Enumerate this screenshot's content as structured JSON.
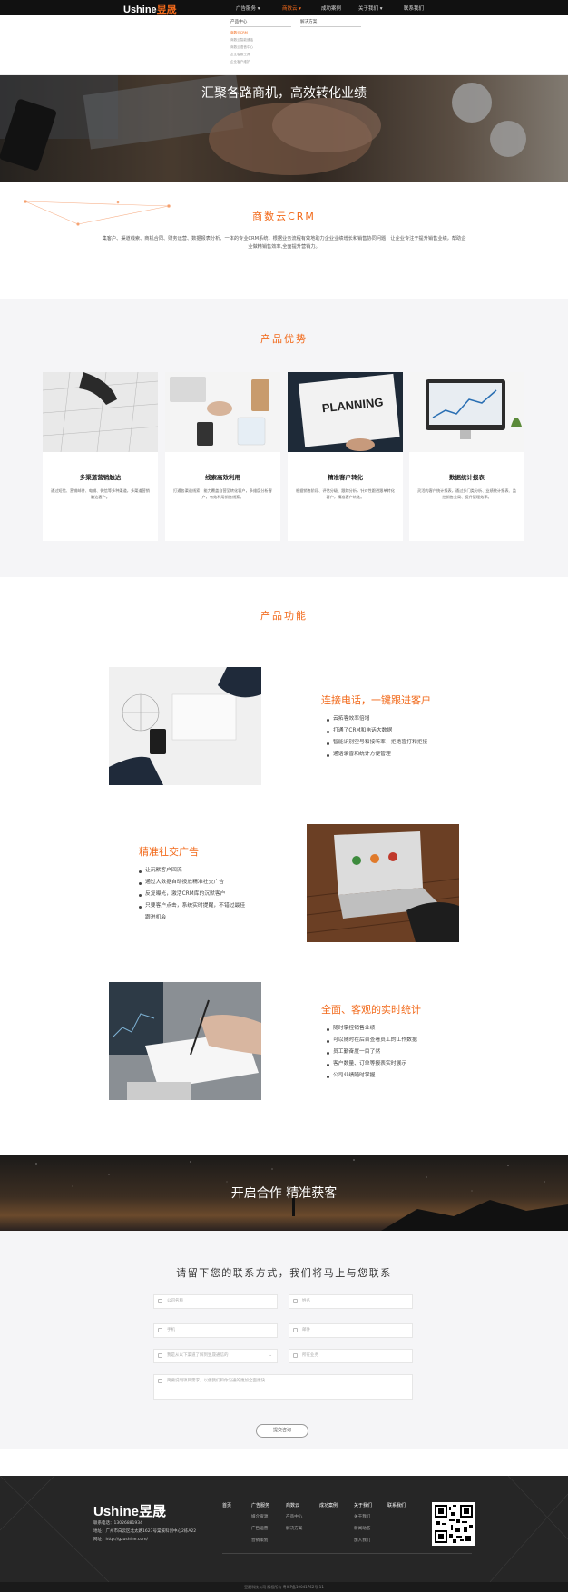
{
  "nav": {
    "logo_latin": "Ushine",
    "logo_cn": "昱晟",
    "items": [
      "广告服务",
      "商数云",
      "成功案例",
      "关于我们",
      "联系我们"
    ],
    "active_index": 1
  },
  "dropdown": {
    "col1_title": "产品中心",
    "col2_title": "解决方案",
    "sub_items": [
      "商数云CRM",
      "商数云智能通话",
      "商数云语音中心",
      "企业客服工具",
      "企业客户维护"
    ]
  },
  "banner": {
    "title": "汇聚各路商机，高效转化业绩"
  },
  "crm": {
    "title": "商数云CRM",
    "desc": "集客户、渠道线索、商机合同、财务运营、数据报表分析、一体的专业CRM系统，根据业务流程有效地助力企业业绩增长和销售协同问题，让企业专注于提升销售业绩，帮助企业做精销售效率,全面提升营销力。"
  },
  "advantages": {
    "title": "产品优势",
    "cards": [
      {
        "title": "多渠道营销触达",
        "desc": "通过短信、营销邮件、电销、微信等多种渠道，多渠道营销触达客户。"
      },
      {
        "title": "线索高效利用",
        "desc": "打通各渠道线索，能力覆盖自营至转化客户，多维度分析客户，有效利用销售线索。"
      },
      {
        "title": "精准客户转化",
        "desc": "根据销售阶段、评估分级、跟踪分析，针对性跟进跟单转化客户，精准客户转化。"
      },
      {
        "title": "数据统计报表",
        "desc": "灵活的客户统计报表，通过多门类分析、业绩统计报表、监控销售全局、提升管理效率。"
      }
    ]
  },
  "features": {
    "title": "产品功能",
    "items": [
      {
        "title": "连接电话，一键跟进客户",
        "bullets": [
          "云拓客效率倍增",
          "打通了CRM和电话大数据",
          "智能识别空号和接听率，拒绝盲打和拒接",
          "通话录音和统计方便管理"
        ]
      },
      {
        "title": "精准社交广告",
        "bullets": [
          "让沉默客户回流",
          "通过大数据自动投放精准社交广告",
          "反复曝光，激活CRM库的沉默客户",
          "只要客户点击，系统实时提醒，不错过最佳跟进机会"
        ]
      },
      {
        "title": "全面、客观的实时统计",
        "bullets": [
          "随时掌控销售业绩",
          "可以随时在后台查看员工的工作数据",
          "员工勤奋度一目了然",
          "客户数量、订单等报表实时展示",
          "公司业绩随时掌握"
        ]
      }
    ]
  },
  "cta": {
    "text": "开启合作  精准获客"
  },
  "form": {
    "title": "请留下您的联系方式，我们将马上与您联系",
    "fields": [
      "公司名称",
      "姓名",
      "手机",
      "邮件",
      "我是从以下渠道了解到昱晟通信的",
      "所在业务"
    ],
    "textarea": "简要说明项目需求，以便我们和你沟通的更加全面更快...",
    "submit": "提交咨询"
  },
  "footer": {
    "logo": "Ushine昱晟",
    "phone": "联系电话：13026881934",
    "address": "地址：广州市白云区北太路1627号棠溪科创中心2栋A22",
    "site": "网址：http://gzushine.com/",
    "cols": [
      {
        "head": "首页",
        "items": []
      },
      {
        "head": "广告服务",
        "items": [
          "媒介资源",
          "广告运营",
          "营销策划"
        ]
      },
      {
        "head": "商数云",
        "items": [
          "产品中心",
          "解决方案"
        ]
      },
      {
        "head": "成功案例",
        "items": []
      },
      {
        "head": "关于我们",
        "items": [
          "关于我们",
          "新闻动态",
          "加入我们"
        ]
      },
      {
        "head": "联系我们",
        "items": []
      }
    ],
    "copyright": "昱晟科技公司 版权所有    粤ICP备19041762号-11"
  }
}
